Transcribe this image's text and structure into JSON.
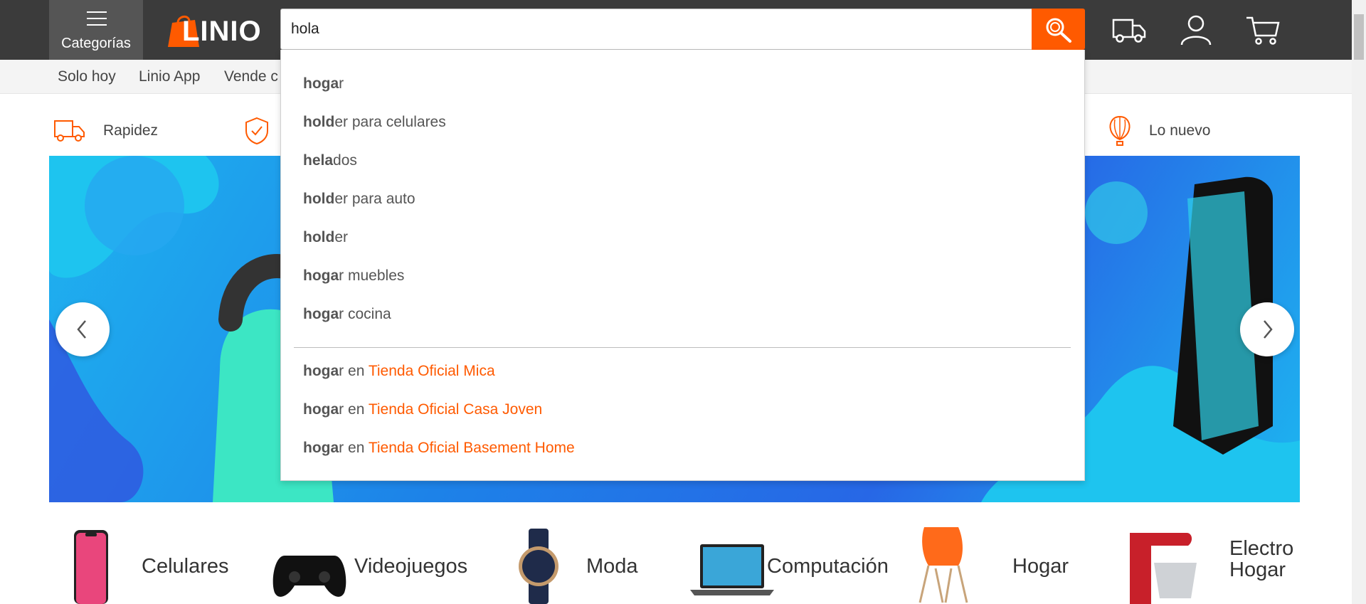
{
  "header": {
    "categories_label": "Categorías",
    "logo_text": "LINIO",
    "search_value": "hola",
    "brand_color": "#ff5a00"
  },
  "subnav": {
    "items": [
      {
        "label": "Solo hoy"
      },
      {
        "label": "Linio App"
      },
      {
        "label": "Vende c"
      }
    ]
  },
  "benefits": [
    {
      "label": "Rapidez",
      "icon": "truck-icon"
    },
    {
      "label": "Lo nuevo",
      "icon": "balloon-icon"
    }
  ],
  "suggestions": [
    {
      "bold": "hoga",
      "rest": "r"
    },
    {
      "bold": "hold",
      "rest": "er para celulares"
    },
    {
      "bold": "hela",
      "rest": "dos"
    },
    {
      "bold": "hold",
      "rest": "er para auto"
    },
    {
      "bold": "hold",
      "rest": "er"
    },
    {
      "bold": "hoga",
      "rest": "r muebles"
    },
    {
      "bold": "hoga",
      "rest": "r cocina"
    }
  ],
  "store_suggestions": [
    {
      "bold": "hoga",
      "rest": "r",
      "connector": "en",
      "store": "Tienda Oficial Mica"
    },
    {
      "bold": "hoga",
      "rest": "r",
      "connector": "en",
      "store": "Tienda Oficial Casa Joven"
    },
    {
      "bold": "hoga",
      "rest": "r",
      "connector": "en",
      "store": "Tienda Oficial Basement Home"
    }
  ],
  "categories": [
    {
      "label": "Celulares",
      "icon": "phone-icon"
    },
    {
      "label": "Videojuegos",
      "icon": "gamepad-icon"
    },
    {
      "label": "Moda",
      "icon": "watch-icon"
    },
    {
      "label": "Computación",
      "icon": "laptop-icon"
    },
    {
      "label": "Hogar",
      "icon": "chair-icon"
    },
    {
      "label_line1": "Electro",
      "label_line2": "Hogar",
      "icon": "mixer-icon"
    }
  ]
}
